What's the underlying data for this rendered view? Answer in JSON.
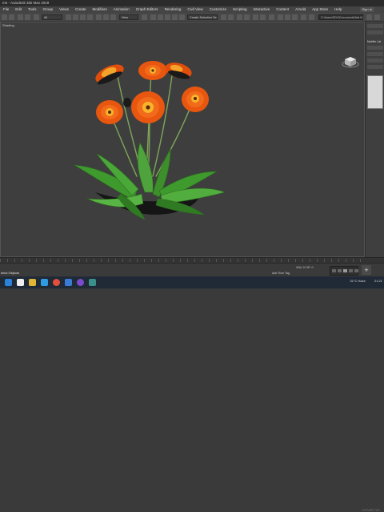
{
  "window": {
    "title": "me - Autodesk 3ds Max 2019"
  },
  "menu": [
    "File",
    "Edit",
    "Tools",
    "Group",
    "Views",
    "Create",
    "Modifiers",
    "Animation",
    "Graph Editors",
    "Rendering",
    "Civil View",
    "Customize",
    "Scripting",
    "Interactive",
    "Content",
    "Arnold",
    "App Store",
    "Help"
  ],
  "signin": "Sign In",
  "toolbar": {
    "filter_value": "All",
    "view_value": "View",
    "selection_set": "Create Selection Se",
    "project_path": "C:\\Users\\SDV\\Documents\\3ds Max 2019"
  },
  "viewport": {
    "label": "Shading"
  },
  "command_panel": {
    "modifier_list": "Modifier List"
  },
  "status": {
    "selection": "elect Objects",
    "coords": "X/W: 0 Y/P: 0",
    "add_tag": "Add Time Tag"
  },
  "watermark": "Activate Wi",
  "taskbar": {
    "weather": "31°C Haze",
    "time": "21:21"
  },
  "colors": {
    "petal": "#e8560f",
    "petal_center": "#f7b42c",
    "leaf": "#3f9a2e",
    "stem": "#7fa65a"
  }
}
